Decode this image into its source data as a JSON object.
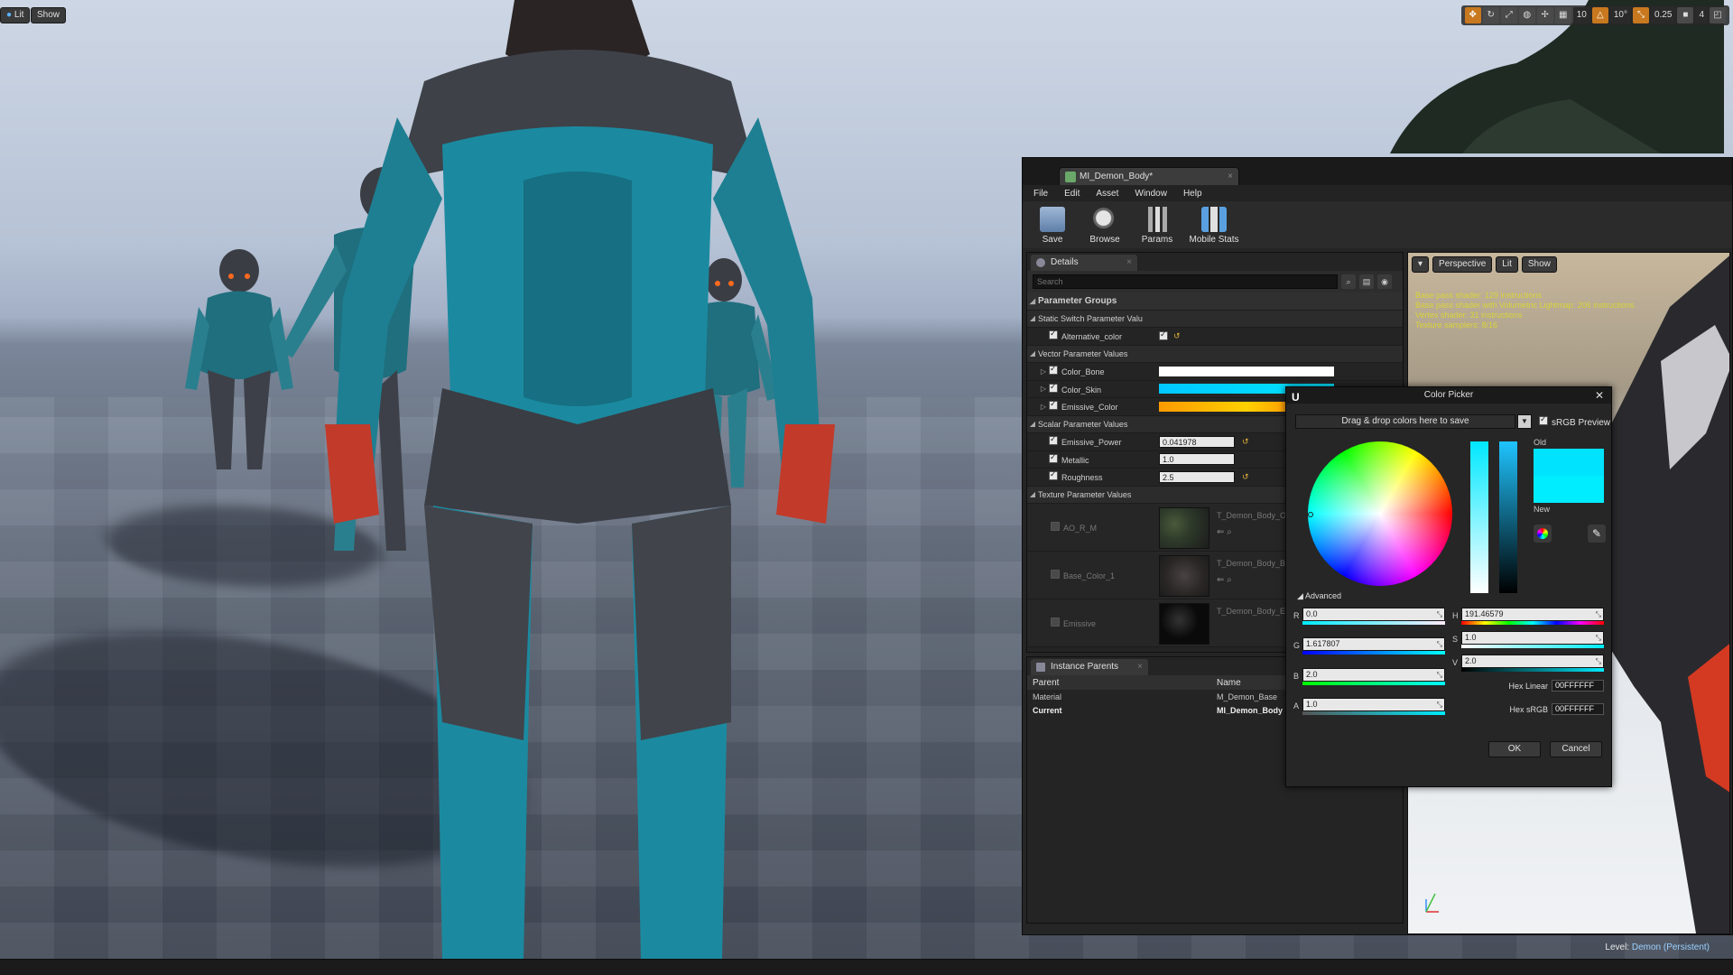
{
  "viewport": {
    "lit_label": "Lit",
    "show_label": "Show",
    "toolbar_right": {
      "grid_snap_value": "10",
      "rotation_snap_value": "10°",
      "scale_snap_value": "0.25",
      "camera_speed_value": "4"
    },
    "level_prefix": "Level:",
    "level_name": "Demon (Persistent)"
  },
  "material_editor": {
    "tab_title": "MI_Demon_Body*",
    "menu": [
      "File",
      "Edit",
      "Asset",
      "Window",
      "Help"
    ],
    "toolbar": [
      {
        "label": "Save",
        "icon": "save-icon"
      },
      {
        "label": "Browse",
        "icon": "browse-icon"
      },
      {
        "label": "Params",
        "icon": "params-icon"
      },
      {
        "label": "Mobile Stats",
        "icon": "mobile-stats-icon"
      }
    ],
    "details": {
      "tab_label": "Details",
      "search_placeholder": "Search",
      "groups_title": "Parameter Groups",
      "static_switch_title": "Static Switch Parameter Valu",
      "alternative_color_label": "Alternative_color",
      "vector_title": "Vector Parameter Values",
      "color_bone_label": "Color_Bone",
      "color_skin_label": "Color_Skin",
      "emissive_color_label": "Emissive_Color",
      "scalar_title": "Scalar Parameter Values",
      "emissive_power_label": "Emissive_Power",
      "emissive_power_value": "0.041978",
      "metallic_label": "Metallic",
      "metallic_value": "1.0",
      "roughness_label": "Roughness",
      "roughness_value": "2.5",
      "texture_title": "Texture Parameter Values",
      "textures": [
        {
          "label": "AO_R_M",
          "name": "T_Demon_Body_O"
        },
        {
          "label": "Base_Color_1",
          "name": "T_Demon_Body_B"
        },
        {
          "label": "Emissive",
          "name": "T_Demon_Body_E"
        }
      ]
    },
    "instance_parents": {
      "tab_label": "Instance Parents",
      "col_parent": "Parent",
      "col_name": "Name",
      "rows": [
        {
          "parent": "Material",
          "name": "M_Demon_Base"
        },
        {
          "parent": "Current",
          "name": "MI_Demon_Body"
        }
      ]
    },
    "preview": {
      "perspective_label": "Perspective",
      "lit_label": "Lit",
      "show_label": "Show",
      "stats": [
        "Base pass shader: 129 instructions",
        "Base pass shader with Volumetric Lightmap: 206 instructions",
        "Vertex shader: 31 instructions",
        "Texture samplers: 8/16"
      ]
    }
  },
  "color_picker": {
    "title": "Color Picker",
    "theme_dropdown": "Drag & drop colors here to save",
    "srgb_preview_label": "sRGB Preview",
    "old_label": "Old",
    "new_label": "New",
    "advanced_label": "Advanced",
    "channels": {
      "R": "0.0",
      "G": "1.617807",
      "B": "2.0",
      "A": "1.0",
      "H": "191.46579",
      "S": "1.0",
      "V": "2.0"
    },
    "hex_linear_label": "Hex Linear",
    "hex_linear_value": "00FFFFFF",
    "hex_srgb_label": "Hex sRGB",
    "hex_srgb_value": "00FFFFFF",
    "ok_label": "OK",
    "cancel_label": "Cancel",
    "colors": {
      "old": "#00e3ff",
      "new": "#00ecff"
    }
  }
}
